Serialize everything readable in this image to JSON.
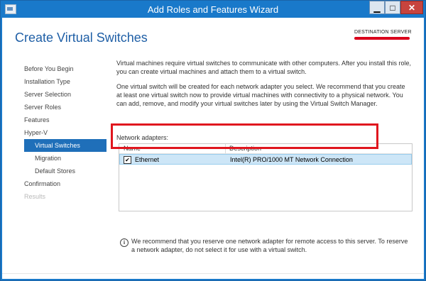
{
  "window": {
    "title": "Add Roles and Features Wizard",
    "buttons": {
      "minimize": "▁",
      "maximize": "□",
      "close": "✕"
    }
  },
  "header": {
    "page_title": "Create Virtual Switches",
    "destination_label": "DESTINATION SERVER"
  },
  "nav": {
    "items": [
      {
        "label": "Before You Begin",
        "state": "normal"
      },
      {
        "label": "Installation Type",
        "state": "normal"
      },
      {
        "label": "Server Selection",
        "state": "normal"
      },
      {
        "label": "Server Roles",
        "state": "normal"
      },
      {
        "label": "Features",
        "state": "normal"
      },
      {
        "label": "Hyper-V",
        "state": "normal"
      },
      {
        "label": "Virtual Switches",
        "state": "active"
      },
      {
        "label": "Migration",
        "state": "sub"
      },
      {
        "label": "Default Stores",
        "state": "sub"
      },
      {
        "label": "Confirmation",
        "state": "normal"
      },
      {
        "label": "Results",
        "state": "disabled"
      }
    ]
  },
  "content": {
    "para1": "Virtual machines require virtual switches to communicate with other computers. After you install this role, you can create virtual machines and attach them to a virtual switch.",
    "para2": "One virtual switch will be created for each network adapter you select. We recommend that you create at least one virtual switch now to provide virtual machines with connectivity to a physical network. You can add, remove, and modify your virtual switches later by using the Virtual Switch Manager.",
    "adapters_label": "Network adapters:",
    "table": {
      "columns": [
        "Name",
        "Description"
      ],
      "rows": [
        {
          "checked": true,
          "check_glyph": "✔",
          "name": "Ethernet",
          "description": "Intel(R) PRO/1000 MT Network Connection"
        }
      ]
    },
    "info_icon": "i",
    "info_text": "We recommend that you reserve one network adapter for remote access to this server. To reserve a network adapter, do not select it for use with a virtual switch."
  },
  "colors": {
    "title_bar": "#1979ca",
    "accent_blue": "#1f6fb9",
    "highlight_red": "#e0161e",
    "row_selected": "#cde6f7"
  }
}
